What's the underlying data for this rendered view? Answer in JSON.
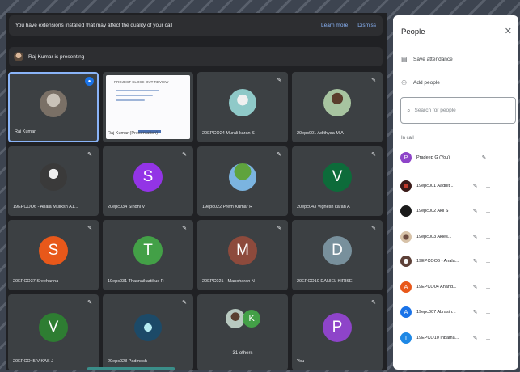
{
  "banner": {
    "message": "You have extensions installed that may affect the quality of your call",
    "learn_more": "Learn more",
    "dismiss": "Dismiss"
  },
  "presenting": {
    "text": "Raj Kumar is presenting"
  },
  "tiles": [
    {
      "name": "Raj Kumar",
      "kind": "photo",
      "speaking": true
    },
    {
      "name": "Raj Kumar (Presentation)",
      "kind": "slide"
    },
    {
      "name": "20EPCO24 Murali karan S",
      "kind": "photo"
    },
    {
      "name": "20epc001 Adithyaa M A",
      "kind": "photo"
    },
    {
      "name": "19EPCOO6 - Anala Muiiksh A1...",
      "kind": "photo"
    },
    {
      "name": "20epc034 Sindhi V",
      "letter": "S",
      "color": "#9334e6",
      "kind": "letter"
    },
    {
      "name": "19epc022 Prem Kumar R",
      "kind": "photo"
    },
    {
      "name": "20epc043 Vignesh karan A",
      "letter": "V",
      "color": "#0d6b3a",
      "kind": "letter"
    },
    {
      "name": "20EPCO37 Sreeharina",
      "letter": "S",
      "color": "#e8581a",
      "kind": "letter"
    },
    {
      "name": "19epc031 Thasnaikartikus R",
      "letter": "T",
      "color": "#43a047",
      "kind": "letter"
    },
    {
      "name": "20EPC021 - Manoharan N",
      "letter": "M",
      "color": "#8d4a3c",
      "kind": "letter"
    },
    {
      "name": "20EPCO10 DANIEL KIRISE",
      "letter": "D",
      "color": "#78909c",
      "kind": "letter"
    },
    {
      "name": "20EPCO45 VIKAS J",
      "letter": "V",
      "color": "#2e7d32",
      "kind": "letter"
    },
    {
      "name": "20epc028 Padmesh",
      "kind": "photo"
    },
    {
      "name": "31 others",
      "kind": "others"
    },
    {
      "name": "You",
      "letter": "P",
      "color": "#8e44c9",
      "kind": "letter"
    }
  ],
  "slide": {
    "title": "PROJECT CLOSE-OUT REVIEW"
  },
  "people_panel": {
    "title": "People",
    "save_attendance": "Save attendance",
    "add_people": "Add people",
    "search_placeholder": "Search for people",
    "in_call": "In call",
    "participants": [
      {
        "name": "Pradeep G (You)",
        "letter": "P",
        "color": "#8e44c9"
      },
      {
        "name": "19epc001 Aadhit...",
        "color": "#4a2420"
      },
      {
        "name": "19epc002 Akil S",
        "color": "#1b1b1b"
      },
      {
        "name": "19epc003 Akles...",
        "color": "#c9a27a"
      },
      {
        "name": "19EPCOO6 - Anala...",
        "color": "#d7ccc8"
      },
      {
        "name": "19EPCO04 Anand...",
        "letter": "A",
        "color": "#e8581a"
      },
      {
        "name": "19epc007 Abrasin...",
        "letter": "A",
        "color": "#1a73e8"
      },
      {
        "name": "19EPCO10 Inbama...",
        "letter": "I",
        "color": "#1e88e5"
      }
    ]
  }
}
